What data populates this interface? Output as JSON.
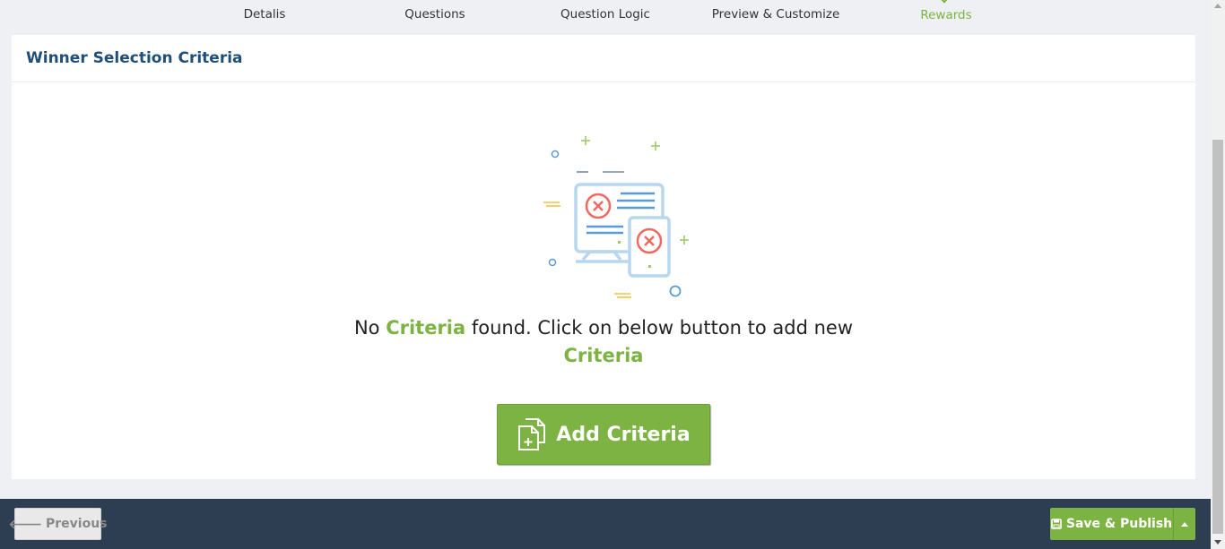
{
  "tabs": [
    {
      "label": "Detalis"
    },
    {
      "label": "Questions"
    },
    {
      "label": "Question Logic"
    },
    {
      "label": "Preview & Customize"
    },
    {
      "label": "Rewards",
      "active": true
    }
  ],
  "card": {
    "title": "Winner Selection Criteria",
    "empty": {
      "prefix": "No ",
      "highlight1": "Criteria",
      "middle": " found. Click on below button to add new ",
      "highlight2": "Criteria"
    },
    "add_button_label": "Add Criteria"
  },
  "footer": {
    "previous_label": "Previous",
    "save_label": "Save & Publish"
  },
  "colors": {
    "accent": "#7cb342",
    "title": "#1f4e79",
    "footer_bg": "#2d3d52",
    "error_red": "#f0695f",
    "illustration_blue": "#5b9bd5"
  },
  "icons": [
    "check-icon",
    "document-add-icon",
    "arrow-left-icon",
    "floppy-disk-icon",
    "caret-up-icon"
  ]
}
